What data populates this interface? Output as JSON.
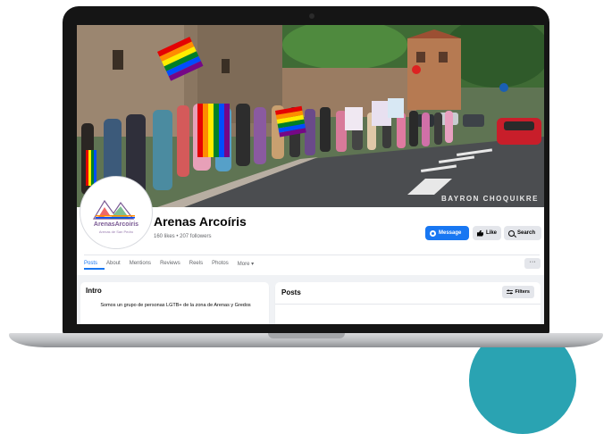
{
  "cover": {
    "credit": "BAYRON CHOQUIKRE"
  },
  "page": {
    "name": "Arenas Arcoíris",
    "stats": "160 likes • 207 followers",
    "avatar_text": "ArenasArcoiris",
    "avatar_subtext": "Arenas de San Pedro"
  },
  "actions": {
    "message_label": "Message",
    "like_label": "Like",
    "search_label": "Search",
    "more_dots": "···"
  },
  "tabs": [
    {
      "label": "Posts",
      "active": true
    },
    {
      "label": "About"
    },
    {
      "label": "Mentions"
    },
    {
      "label": "Reviews"
    },
    {
      "label": "Reels"
    },
    {
      "label": "Photos"
    },
    {
      "label": "More ▾"
    }
  ],
  "intro": {
    "title": "Intro",
    "text": "Somos un grupo de personas LGTB+ de la zona de Arenas y Gredos"
  },
  "posts": {
    "title": "Posts",
    "filters_label": "Filters"
  },
  "colors": {
    "accent": "#1877f2",
    "button_gray": "#e4e6eb",
    "page_bg": "#f0f2f5",
    "teal_circle": "#2aa3b2"
  }
}
